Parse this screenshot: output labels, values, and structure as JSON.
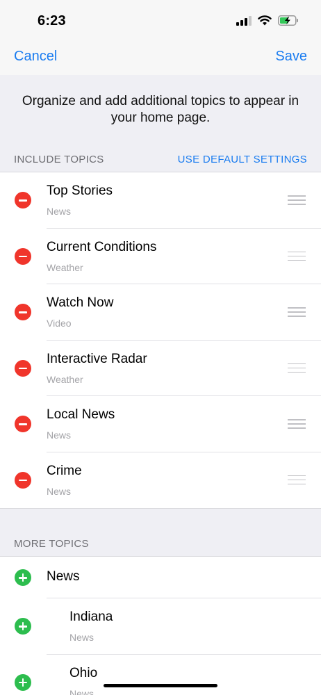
{
  "status_bar": {
    "time": "6:23"
  },
  "nav": {
    "cancel_label": "Cancel",
    "save_label": "Save"
  },
  "intro_text": "Organize and add additional topics to appear in your home page.",
  "include_section": {
    "title": "INCLUDE TOPICS",
    "action_label": "USE DEFAULT SETTINGS",
    "items": [
      {
        "title": "Top Stories",
        "category": "News"
      },
      {
        "title": "Current Conditions",
        "category": "Weather"
      },
      {
        "title": "Watch Now",
        "category": "Video"
      },
      {
        "title": "Interactive Radar",
        "category": "Weather"
      },
      {
        "title": "Local News",
        "category": "News"
      },
      {
        "title": "Crime",
        "category": "News"
      }
    ]
  },
  "more_section": {
    "title": "MORE TOPICS",
    "items": [
      {
        "title": "News"
      },
      {
        "title": "Indiana",
        "category": "News"
      },
      {
        "title": "Ohio",
        "category": "News"
      }
    ]
  },
  "colors": {
    "accent": "#1a7cf0",
    "remove": "#f0352b",
    "add": "#2dbd4e"
  }
}
